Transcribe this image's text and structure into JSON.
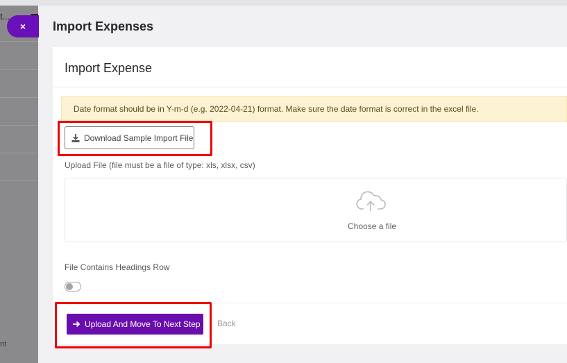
{
  "sidebar": {
    "title_fragment": "t...",
    "footer_fragment": "nt"
  },
  "close_button": {
    "label": "×"
  },
  "drawer": {
    "title": "Import Expenses"
  },
  "card": {
    "title": "Import Expense",
    "alert_text": "Date format should be in Y-m-d (e.g. 2022-04-21) format. Make sure the date format is correct in the excel file.",
    "download_button": {
      "label": "Download Sample Import File",
      "icon": "download-icon"
    },
    "upload_label": "Upload File (file must be a file of type: xls, xlsx, csv)",
    "dropzone": {
      "text": "Choose a file",
      "icon": "cloud-upload-icon"
    },
    "headings_label": "File Contains Headings Row",
    "headings_toggle": {
      "checked": false
    },
    "primary_button": {
      "label": "Upload And Move To Next Step",
      "icon": "arrow-right-icon"
    },
    "back_link": "Back"
  },
  "colors": {
    "accent": "#6a0dad",
    "alert_bg": "#fcf3d4",
    "highlight": "#ee0000"
  }
}
